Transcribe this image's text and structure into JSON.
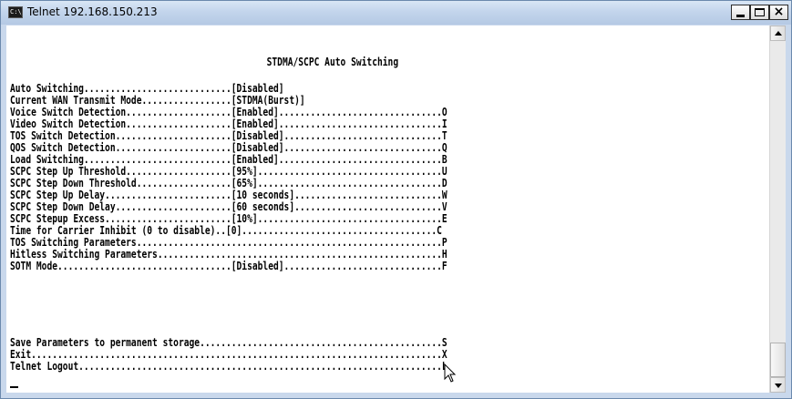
{
  "window": {
    "title": "Telnet 192.168.150.213",
    "icon_label": "C:\\_",
    "controls": {
      "minimize": "minimize-icon",
      "maximize": "maximize-icon",
      "close": "×"
    }
  },
  "console": {
    "heading": "STDMA/SCPC Auto Switching",
    "menu_rows": [
      "Auto Switching............................[Disabled]",
      "Current WAN Transmit Mode.................[STDMA(Burst)]",
      "Voice Switch Detection....................[Enabled]...............................O",
      "Video Switch Detection....................[Enabled]...............................I",
      "TOS Switch Detection......................[Disabled]..............................T",
      "QOS Switch Detection......................[Disabled]..............................Q",
      "Load Switching............................[Enabled]...............................B",
      "SCPC Step Up Threshold....................[95%]...................................U",
      "SCPC Step Down Threshold..................[65%]...................................D",
      "SCPC Step Up Delay........................[10 seconds]............................W",
      "SCPC Step Down Delay......................[60 seconds]............................V",
      "SCPC Stepup Excess........................[10%]...................................E",
      "Time for Carrier Inhibit (0 to disable)..[0].....................................C",
      "TOS Switching Parameters..........................................................P",
      "Hitless Switching Parameters......................................................H",
      "SOTM Mode.................................[Disabled]..............................F"
    ],
    "action_rows": [
      "Save Parameters to permanent storage..............................................S",
      "Exit..............................................................................X",
      "Telnet Logout.....................................................................L"
    ]
  },
  "scrollbar": {
    "up_icon": "scroll-up-icon",
    "down_icon": "scroll-down-icon",
    "position": "bottom"
  },
  "colors": {
    "console_bg": "#ffffff",
    "console_text": "#000000",
    "titlebar": "#c3d5ec"
  }
}
